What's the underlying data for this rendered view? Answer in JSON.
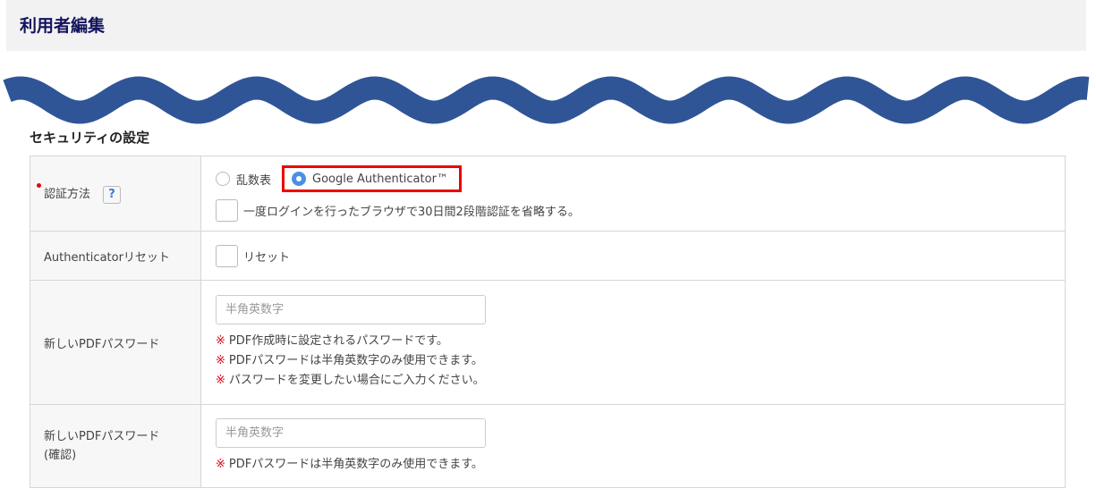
{
  "header": {
    "title": "利用者編集"
  },
  "section": {
    "title": "セキュリティの設定"
  },
  "auth": {
    "label": "認証方法",
    "help": "?",
    "options": [
      "乱数表",
      "Google Authenticator™"
    ],
    "selected": "Google Authenticator™",
    "skip_label": "一度ログインを行ったブラウザで30日間2段階認証を省略する。"
  },
  "reset": {
    "label": "Authenticatorリセット",
    "checkbox_label": "リセット"
  },
  "pdf": {
    "label": "新しいPDFパスワード",
    "placeholder": "半角英数字",
    "mark": "※",
    "notes": [
      "PDF作成時に設定されるパスワードです。",
      "PDFパスワードは半角英数字のみ使用できます。",
      "パスワードを変更したい場合にご入力ください。"
    ]
  },
  "pdf_confirm": {
    "label_line1": "新しいPDFパスワード",
    "label_line2": "(確認)",
    "placeholder": "半角英数字",
    "notes": [
      "PDFパスワードは半角英数字のみ使用できます。"
    ]
  },
  "colors": {
    "title": "#14145e",
    "wave": "#2f5597",
    "highlight": "#e00000",
    "required": "#e60012"
  }
}
